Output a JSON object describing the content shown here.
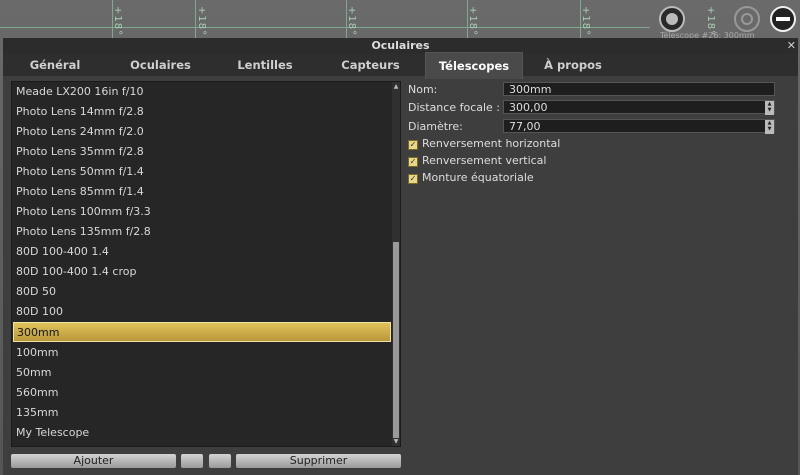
{
  "sky": {
    "grid_labels": [
      "+18°",
      "+18°",
      "+18°",
      "+18°",
      "+18°",
      "+18°"
    ],
    "telescope_label": "Télescope #26: 300mm"
  },
  "window": {
    "title": "Oculaires",
    "tabs": [
      "Général",
      "Oculaires",
      "Lentilles",
      "Capteurs",
      "Télescopes",
      "À propos"
    ],
    "active_tab": "Télescopes"
  },
  "telescopes": {
    "items": [
      "Meade  LX200 16in f/10",
      "Photo Lens 14mm f/2.8",
      "Photo Lens 24mm f/2.0",
      "Photo Lens 35mm f/2.8",
      "Photo Lens 50mm f/1.4",
      "Photo Lens 85mm f/1.4",
      "Photo Lens 100mm f/3.3",
      "Photo Lens 135mm f/2.8",
      "80D 100-400 1.4",
      "80D 100-400 1.4 crop",
      "80D 50",
      "80D 100",
      "300mm",
      "100mm",
      "50mm",
      "560mm",
      "135mm",
      "My Telescope"
    ],
    "selected": "300mm",
    "buttons": {
      "add": "Ajouter",
      "remove": "Supprimer"
    }
  },
  "form": {
    "name_label": "Nom:",
    "name_value": "300mm",
    "focal_label": "Distance focale :",
    "focal_value": "300,00",
    "diameter_label": "Diamètre:",
    "diameter_value": "77,00",
    "checks": [
      {
        "label": "Renversement horizontal",
        "checked": true
      },
      {
        "label": "Renversement vertical",
        "checked": true
      },
      {
        "label": "Monture équatoriale",
        "checked": true
      }
    ]
  },
  "colors": {
    "selection": "#d1b24a",
    "panel": "#3e3e3e",
    "grid": "#7fa890"
  }
}
